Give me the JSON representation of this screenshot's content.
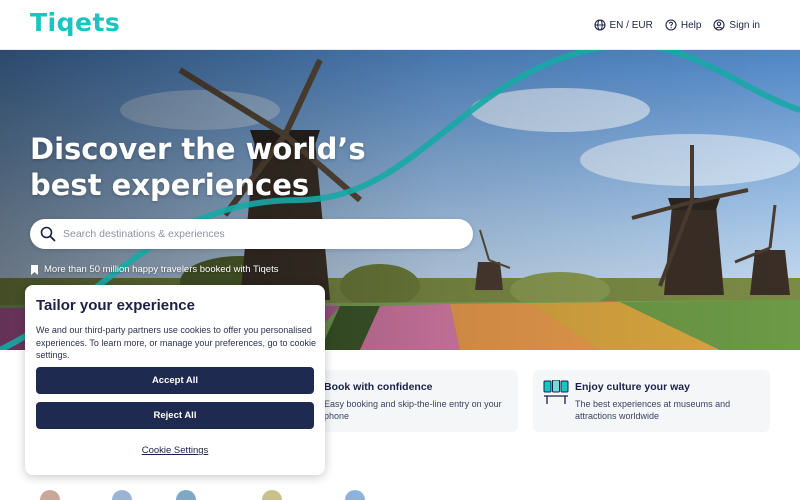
{
  "header": {
    "logo": "Tiqets",
    "nav": [
      {
        "label": "EN / EUR",
        "icon": "globe-icon"
      },
      {
        "label": "Help",
        "icon": "help-circle-icon"
      },
      {
        "label": "Sign in",
        "icon": "user-circle-icon"
      }
    ]
  },
  "hero": {
    "title": "Discover the world’s best experiences",
    "search_placeholder": "Search destinations & experiences",
    "trust_text": "More than 50 million happy travelers booked with Tiqets",
    "trust_icon": "bookmark-icon"
  },
  "cards": [
    {
      "title": "Book with confidence",
      "description": "Easy booking and skip-the-line entry on your phone"
    },
    {
      "title": "Enjoy culture your way",
      "description": "The best experiences at museums and attractions worldwide",
      "icon": "museum-icon"
    }
  ],
  "cookie": {
    "title": "Tailor your experience",
    "text": "We and our third-party partners use cookies to offer you personalised experiences. To learn more, or manage your preferences, go to cookie settings.",
    "accept_label": "Accept All",
    "reject_label": "Reject All",
    "settings_label": "Cookie Settings"
  },
  "colors": {
    "brand": "#19c5c0",
    "navy": "#1e2a4f",
    "card_bg": "#f4f6f8"
  }
}
